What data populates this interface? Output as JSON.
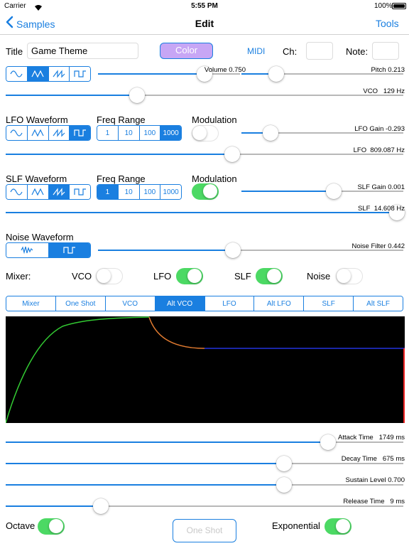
{
  "status_bar": {
    "carrier": "Carrier",
    "time": "5:55 PM",
    "battery": "100%"
  },
  "nav": {
    "back_label": "Samples",
    "title": "Edit",
    "tools_label": "Tools"
  },
  "header": {
    "title_label": "Title",
    "title_value": "Game Theme",
    "color_label": "Color",
    "midi_label": "MIDI",
    "ch_label": "Ch:",
    "ch_value": "",
    "note_label": "Note:",
    "note_value": ""
  },
  "vco": {
    "waveform_selected": 1,
    "volume": {
      "label": "Volume 0.750",
      "value": 0.75
    },
    "pitch": {
      "label": "Pitch 0.213",
      "value": 0.213
    },
    "freq": {
      "label": "VCO",
      "readout": "129 Hz",
      "position": 0.33
    }
  },
  "lfo": {
    "waveform_label": "LFO Waveform",
    "freq_range_label": "Freq Range",
    "modulation_label": "Modulation",
    "waveform_selected": 3,
    "ranges": [
      "1",
      "10",
      "100",
      "1000"
    ],
    "range_selected": 3,
    "modulation_on": false,
    "gain": {
      "label": "LFO Gain -0.293",
      "value": 0.18
    },
    "freq": {
      "label": "LFO",
      "readout": "809.087 Hz",
      "position": 0.57
    }
  },
  "slf": {
    "waveform_label": "SLF Waveform",
    "freq_range_label": "Freq Range",
    "modulation_label": "Modulation",
    "waveform_selected": 2,
    "ranges": [
      "1",
      "10",
      "100",
      "1000"
    ],
    "range_selected": 0,
    "modulation_on": true,
    "gain": {
      "label": "SLF Gain 0.001",
      "value": 0.57
    },
    "freq": {
      "label": "SLF",
      "readout": "14.608 Hz",
      "position": 0.99
    }
  },
  "noise": {
    "waveform_label": "Noise Waveform",
    "waveform_selected": 1,
    "filter": {
      "label": "Noise Filter 0.442",
      "value": 0.442
    }
  },
  "mixer": {
    "label": "Mixer:",
    "channels": [
      {
        "name": "VCO",
        "on": false
      },
      {
        "name": "LFO",
        "on": true
      },
      {
        "name": "SLF",
        "on": true
      },
      {
        "name": "Noise",
        "on": false
      }
    ]
  },
  "tabs": {
    "items": [
      "Mixer",
      "One Shot",
      "VCO",
      "Alt VCO",
      "LFO",
      "Alt LFO",
      "SLF",
      "Alt SLF"
    ],
    "selected": 3
  },
  "envelope": {
    "attack": {
      "label": "Attack Time",
      "readout": "1749 ms",
      "position": 0.81
    },
    "decay": {
      "label": "Decay Time",
      "readout": "675 ms",
      "position": 0.7
    },
    "sustain": {
      "label": "Sustain Level 0.700",
      "value": 0.7
    },
    "release": {
      "label": "Release Time",
      "readout": "9 ms",
      "position": 0.24
    }
  },
  "footer": {
    "octave_label": "Octave",
    "octave_on": true,
    "one_shot_label": "One Shot",
    "exponential_label": "Exponential",
    "exponential_on": true
  },
  "colors": {
    "accent": "#1a7fe0",
    "toggle_on": "#4cd964",
    "attack_curve": "#33cc33",
    "decay_curve": "#e07a30",
    "sustain_line": "#2233dd",
    "release_marker": "#ee2222",
    "graph_bg": "#000000",
    "color_button": "#c7a6f5"
  }
}
